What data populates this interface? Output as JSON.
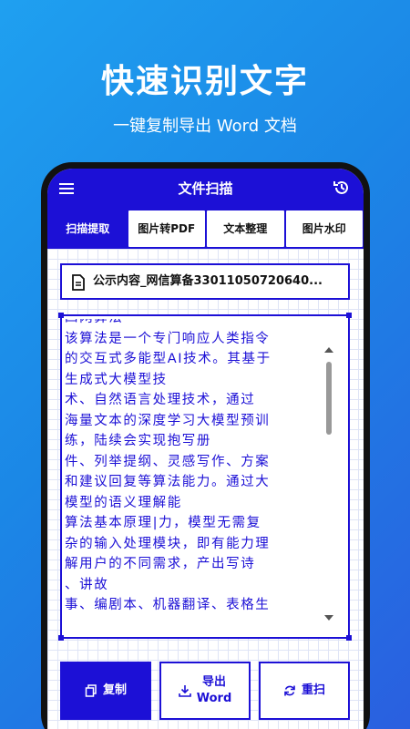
{
  "promo": {
    "headline": "快速识别文字",
    "subline": "一键复制导出 Word 文档"
  },
  "app": {
    "title": "文件扫描",
    "tabs": [
      {
        "label": "扫描提取",
        "active": true
      },
      {
        "label": "图片转PDF",
        "active": false
      },
      {
        "label": "文本整理",
        "active": false
      },
      {
        "label": "图片水印",
        "active": false
      }
    ],
    "file_name": "公示内容_网信算备33011050720640...",
    "text_lines": [
      "四网算法",
      "该算法是一个专门响应人类指令",
      "的交互式多能型AI技术。其基于",
      "生成式大模型技",
      "术、自然语言处理技术，通过",
      "海量文本的深度学习大模型预训",
      "练，陆续会实现抱写册",
      "件、列举提纲、灵感写作、方案",
      "和建议回复等算法能力。通过大",
      "模型的语义理解能",
      "算法基本原理|力，模型无需复",
      "杂的输入处理模块，即有能力理",
      "解用户的不同需求，产出写诗",
      "、讲故",
      "事、编剧本、机器翻译、表格生"
    ],
    "buttons": {
      "copy": "复制",
      "export_line1": "导出",
      "export_line2": "Word",
      "rescan": "重扫"
    },
    "accent_color": "#1c10d6"
  }
}
